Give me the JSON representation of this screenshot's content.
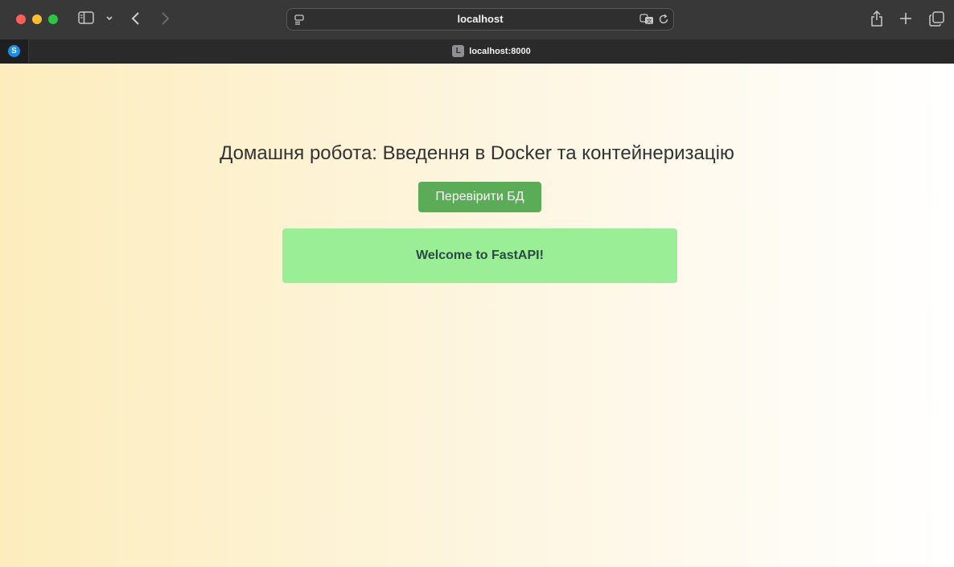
{
  "browser": {
    "address": "localhost",
    "tabs": [
      {
        "pinned": true,
        "favicon_letter": "S",
        "favicon_color": "#1d8ee8"
      },
      {
        "favicon_letter": "L",
        "title": "localhost:8000",
        "active": true
      }
    ],
    "icons": {
      "sidebar": "sidebar-icon",
      "back": "chevron-left-icon",
      "forward": "chevron-right-icon",
      "page_menu": "page-menu-icon",
      "translate": "translate-icon",
      "reload": "reload-icon",
      "share": "share-icon",
      "new_tab": "plus-icon",
      "tab_overview": "tabs-overview-icon"
    }
  },
  "page": {
    "title": "Домашня робота: Введення в Docker та контейнеризацію",
    "check_db_button": "Перевірити БД",
    "message": "Welcome to FastAPI!",
    "colors": {
      "button": "#5aac56",
      "message_bg": "#9aee96",
      "gradient_start": "#fdedbd",
      "gradient_end": "#ffffff"
    }
  }
}
